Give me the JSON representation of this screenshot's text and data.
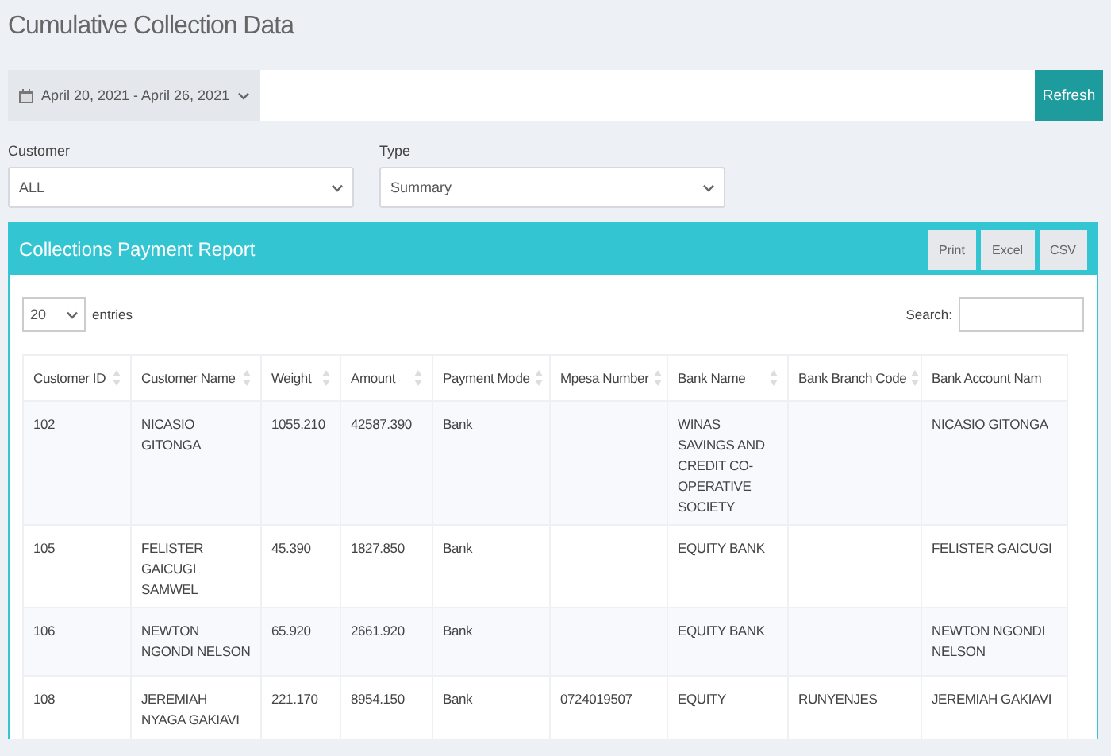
{
  "page": {
    "title": "Cumulative Collection Data"
  },
  "toolbar": {
    "date_range": "April 20, 2021 - April 26, 2021",
    "refresh": "Refresh"
  },
  "filters": [
    {
      "label": "Customer",
      "value": "ALL"
    },
    {
      "label": "Type",
      "value": "Summary"
    }
  ],
  "report": {
    "title": "Collections Payment Report",
    "buttons": [
      "Print",
      "Excel",
      "CSV"
    ],
    "page_size": "20",
    "entries_label": "entries",
    "search_label": "Search:",
    "table": {
      "columns": [
        "Customer ID",
        "Customer Name",
        "Weight",
        "Amount",
        "Payment Mode",
        "Mpesa Number",
        "Bank Name",
        "Bank Branch Code",
        "Bank Account Nam"
      ],
      "rows": [
        [
          "102",
          "NICASIO GITONGA",
          "1055.210",
          "42587.390",
          "Bank",
          "",
          "WINAS SAVINGS AND CREDIT CO-OPERATIVE SOCIETY",
          "",
          "NICASIO GITONGA"
        ],
        [
          "105",
          "FELISTER GAICUGI SAMWEL",
          "45.390",
          "1827.850",
          "Bank",
          "",
          "EQUITY BANK",
          "",
          "FELISTER GAICUGI"
        ],
        [
          "106",
          "NEWTON NGONDI NELSON",
          "65.920",
          "2661.920",
          "Bank",
          "",
          "EQUITY BANK",
          "",
          "NEWTON NGONDI NELSON"
        ],
        [
          "108",
          "JEREMIAH NYAGA GAKIAVI",
          "221.170",
          "8954.150",
          "Bank",
          "0724019507",
          "EQUITY",
          "RUNYENJES",
          "JEREMIAH GAKIAVI"
        ]
      ]
    }
  }
}
